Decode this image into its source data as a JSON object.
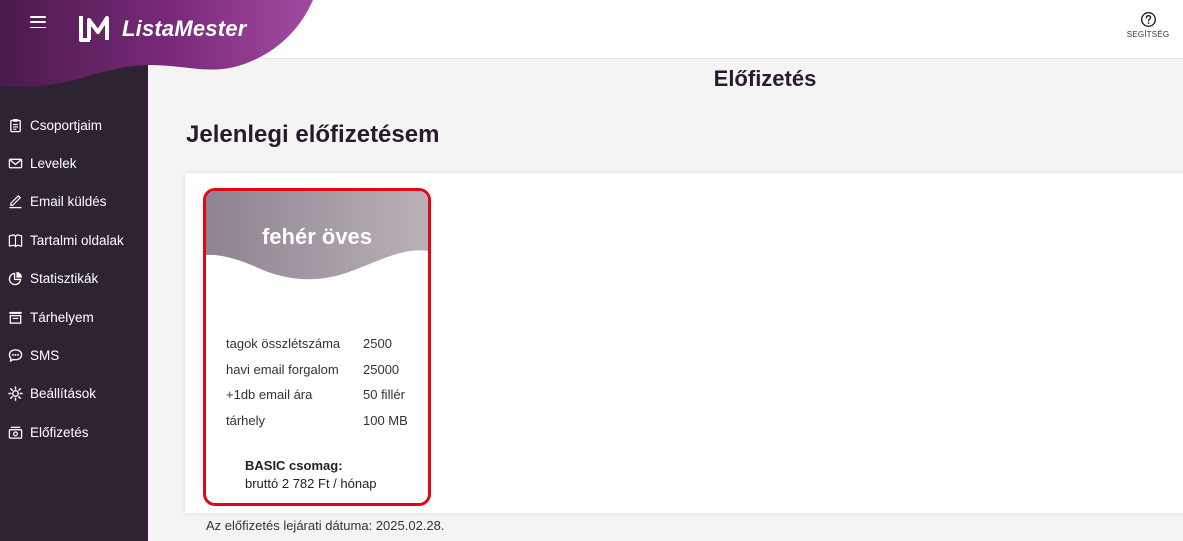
{
  "app": {
    "brand": "ListaMester",
    "brand_colors": {
      "purple_dark": "#4a1a4a",
      "purple": "#9b3a9b",
      "sidebar": "#2e2330",
      "highlight": "#e30613"
    }
  },
  "topbar": {
    "menu_icon": "hamburger-icon",
    "help_label": "SEGÍTSÉG",
    "help_icon": "question-circle-icon"
  },
  "sidebar": {
    "items": [
      {
        "label": "Csoportjaim",
        "icon": "clipboard-icon"
      },
      {
        "label": "Levelek",
        "icon": "envelope-icon"
      },
      {
        "label": "Email küldés",
        "icon": "pencil-icon"
      },
      {
        "label": "Tartalmi oldalak",
        "icon": "book-icon"
      },
      {
        "label": "Statisztikák",
        "icon": "pie-chart-icon"
      },
      {
        "label": "Tárhelyem",
        "icon": "storage-icon"
      },
      {
        "label": "SMS",
        "icon": "chat-bubble-icon"
      },
      {
        "label": "Beállítások",
        "icon": "gear-icon"
      },
      {
        "label": "Előfizetés",
        "icon": "subscription-icon"
      }
    ]
  },
  "main": {
    "page_title": "Előfizetés",
    "section_title": "Jelenlegi előfizetésem",
    "card": {
      "name": "fehér öves",
      "features": [
        {
          "key": "tagok összlétszáma",
          "value": "2500"
        },
        {
          "key": "havi email forgalom",
          "value": "25000"
        },
        {
          "key": "+1db email ára",
          "value": "50 fillér"
        },
        {
          "key": "tárhely",
          "value": "100 MB"
        }
      ],
      "package_name": "BASIC csomag:",
      "package_price": "bruttó 2 782 Ft / hónap"
    },
    "expiry_text": "Az előfizetés lejárati dátuma: 2025.02.28."
  }
}
